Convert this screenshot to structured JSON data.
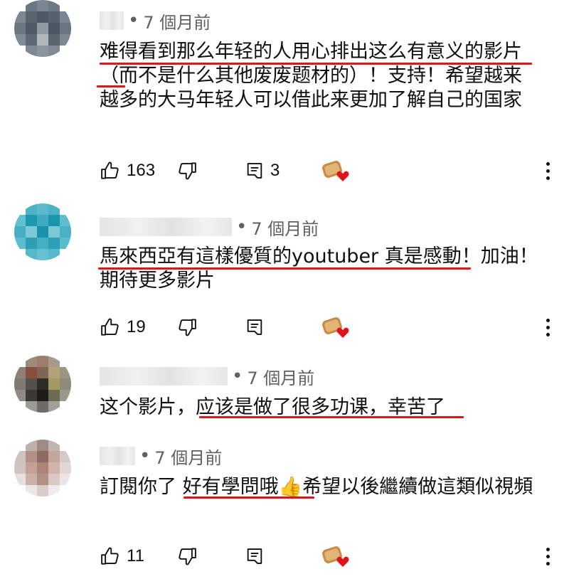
{
  "comments": [
    {
      "time": "7 個月前",
      "text": "难得看到那么年轻的人用心排出这么有意义的影片（而不是什么其他废废题材的）！支持！希望越来越多的大马年轻人可以借此来更加了解自己的国家",
      "likes": "163",
      "replies": "3"
    },
    {
      "time": "7 個月前",
      "text": "馬來西亞有這樣優質的youtuber 真是感動！加油！期待更多影片",
      "likes": "19",
      "replies": ""
    },
    {
      "time": "7 個月前",
      "text": "这个影片，应该是做了很多功课，幸苦了",
      "likes": "",
      "replies": ""
    },
    {
      "time": "7 個月前",
      "text": "訂閱你了 好有學問哦👍希望以後繼續做這類似視頻",
      "likes": "11",
      "replies": ""
    }
  ],
  "icons": {
    "like": "thumb-up-icon",
    "dislike": "thumb-down-icon",
    "reply": "reply-icon",
    "heart": "creator-heart-icon",
    "more": "more-vert-icon"
  },
  "colors": {
    "underline": "#e0151b",
    "meta_text": "#606060",
    "heart": "#e0151b"
  }
}
